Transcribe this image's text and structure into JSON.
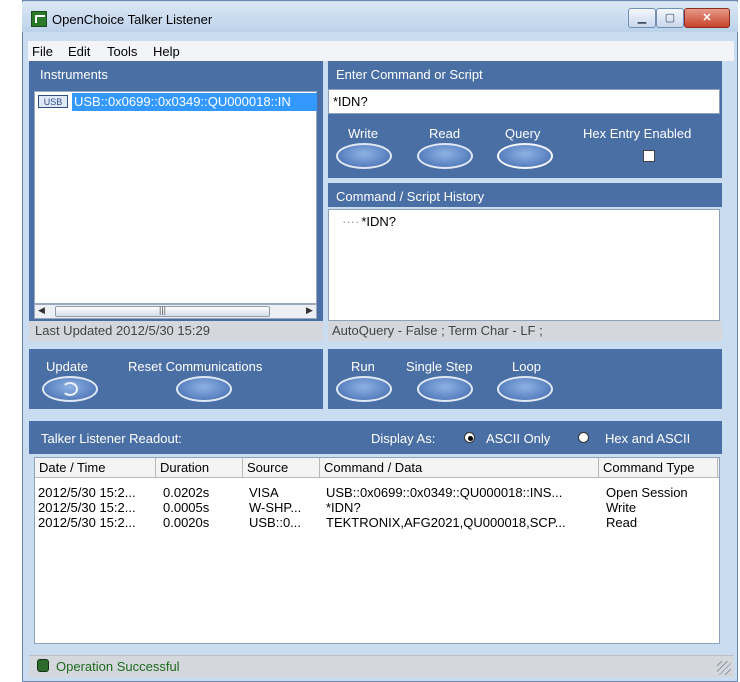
{
  "window": {
    "title": "OpenChoice Talker Listener"
  },
  "menu": [
    "File",
    "Edit",
    "Tools",
    "Help"
  ],
  "instruments": {
    "label": "Instruments",
    "items": [
      {
        "tag": "USB",
        "text": "USB::0x0699::0x0349::QU000018::IN"
      }
    ],
    "last_updated": "Last Updated 2012/5/30 15:29"
  },
  "command": {
    "label": "Enter Command or Script",
    "value": "*IDN?",
    "write_label": "Write",
    "read_label": "Read",
    "query_label": "Query",
    "hex_entry_label": "Hex Entry Enabled"
  },
  "history": {
    "label": "Command / Script History",
    "items": [
      "*IDN?"
    ],
    "autoquery": "AutoQuery - False ; Term Char - LF  ;"
  },
  "actions": {
    "update_label": "Update",
    "reset_label": "Reset Communications",
    "run_label": "Run",
    "single_step_label": "Single Step",
    "loop_label": "Loop"
  },
  "readout": {
    "label": "Talker Listener Readout:",
    "display_as_label": "Display As:",
    "ascii_only_label": "ASCII Only",
    "hex_ascii_label": "Hex and ASCII",
    "columns": [
      "Date / Time",
      "Duration",
      "Source",
      "Command / Data",
      "Command Type"
    ],
    "rows": [
      [
        "2012/5/30 15:2...",
        "0.0202s",
        "VISA",
        "USB::0x0699::0x0349::QU000018::INS...",
        "Open Session"
      ],
      [
        "2012/5/30 15:2...",
        "0.0005s",
        "W-SHP...",
        "*IDN?",
        "Write"
      ],
      [
        "2012/5/30 15:2...",
        "0.0020s",
        "USB::0...",
        "TEKTRONIX,AFG2021,QU000018,SCP...",
        "Read"
      ]
    ]
  },
  "status": {
    "text": "Operation Successful"
  },
  "colors": {
    "panel": "#4a6fa5",
    "selection": "#3399ff",
    "status_text": "#1e6a1e"
  }
}
